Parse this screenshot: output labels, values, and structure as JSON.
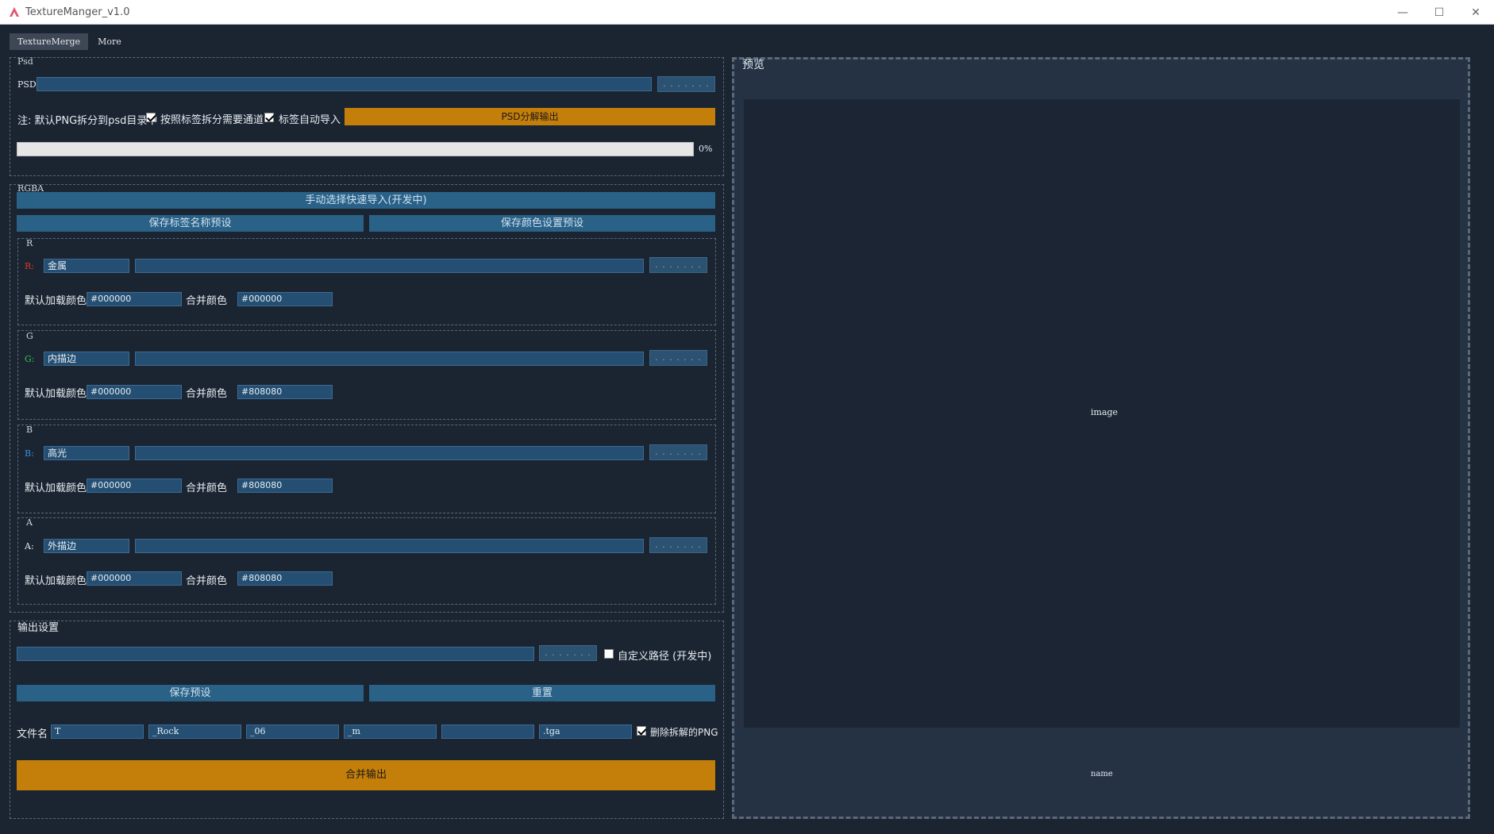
{
  "window": {
    "title": "TextureManger_v1.0"
  },
  "tabs": [
    {
      "label": "TextureMerge"
    },
    {
      "label": "More"
    }
  ],
  "psd": {
    "group_label": "Psd",
    "field_label": "PSD",
    "path_value": "",
    "browse_label": ". . . . . . .",
    "note": "注: 默认PNG拆分到psd目录中",
    "split_by_label": "按照标签拆分需要通道",
    "split_by_checked": true,
    "auto_import": "标签自动导入",
    "auto_import_checked": true,
    "export_button": "PSD分解输出",
    "progress_label": "0%",
    "progress": 0
  },
  "rgba": {
    "group_label": "RGBA",
    "quick_import": "手动选择快速导入(开发中)",
    "save_tag_preset": "保存标签名称预设",
    "save_color_preset": "保存颜色设置预设",
    "default_color_label": "默认加载颜色",
    "merge_color_label": "合并颜色",
    "browse_label": ". . . . . . .",
    "channels": [
      {
        "group": "R",
        "prefix": "R:",
        "tag": "金属",
        "path": "",
        "default_color": "#000000",
        "merge_color": "#000000",
        "color": "#e0352b"
      },
      {
        "group": "G",
        "prefix": "G:",
        "tag": "内描边",
        "path": "",
        "default_color": "#000000",
        "merge_color": "#808080",
        "color": "#39c24a"
      },
      {
        "group": "B",
        "prefix": "B:",
        "tag": "高光",
        "path": "",
        "default_color": "#000000",
        "merge_color": "#808080",
        "color": "#3a8fe0"
      },
      {
        "group": "A",
        "prefix": "A:",
        "tag": "外描边",
        "path": "",
        "default_color": "#000000",
        "merge_color": "#808080",
        "color": "#e6ecf2"
      }
    ]
  },
  "output": {
    "group_label": "输出设置",
    "path_value": "",
    "browse_label": ". . . . . . .",
    "custom_path_label": "自定义路径 (开发中)",
    "custom_path_checked": false,
    "save_preset": "保存预设",
    "reset": "重置",
    "filename_label": "文件名",
    "filename_parts": [
      "T",
      "_Rock",
      "_06",
      "_m",
      "",
      ".tga"
    ],
    "delete_png_label": "删除拆解的PNG",
    "delete_png_checked": true,
    "merge_button": "合并输出"
  },
  "preview": {
    "label": "预览",
    "image_placeholder": "image",
    "name_placeholder": "name"
  },
  "colors": {
    "accent_orange": "#c47e0a",
    "field_blue": "#244f73",
    "bg": "#1b2431"
  }
}
